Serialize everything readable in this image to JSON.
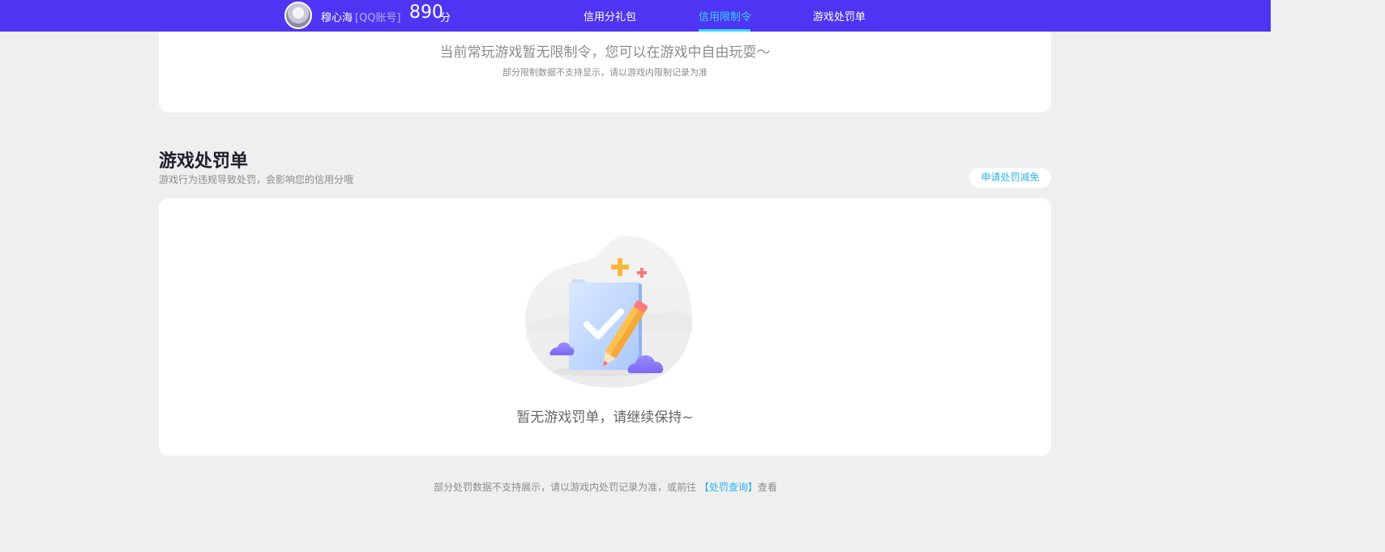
{
  "header": {
    "username": "穆心海",
    "account_type": "[QQ账号]",
    "score": "890",
    "score_unit": "分",
    "tabs": [
      {
        "label": "信用分礼包",
        "active": false
      },
      {
        "label": "信用限制令",
        "active": true
      },
      {
        "label": "游戏处罚单",
        "active": false
      }
    ],
    "colors": {
      "bar": "#4f35f3",
      "active_tab": "#36d7ff"
    }
  },
  "restriction": {
    "message": "当前常玩游戏暂无限制令，您可以在游戏中自由玩耍～",
    "note": "部分限制数据不支持显示，请以游戏内限制记录为准"
  },
  "penalty": {
    "title": "游戏处罚单",
    "subtitle": "游戏行为违规导致处罚，会影响您的信用分哦",
    "apply_button": "申请处罚减免",
    "empty_message": "暂无游戏罚单，请继续保持~",
    "empty_icon": "checklist-pencil-illustration"
  },
  "footer": {
    "text_before": "部分处罚数据不支持展示，请以游戏内处罚记录为准，或前往",
    "link": "【处罚查询】",
    "text_after": "查看"
  }
}
